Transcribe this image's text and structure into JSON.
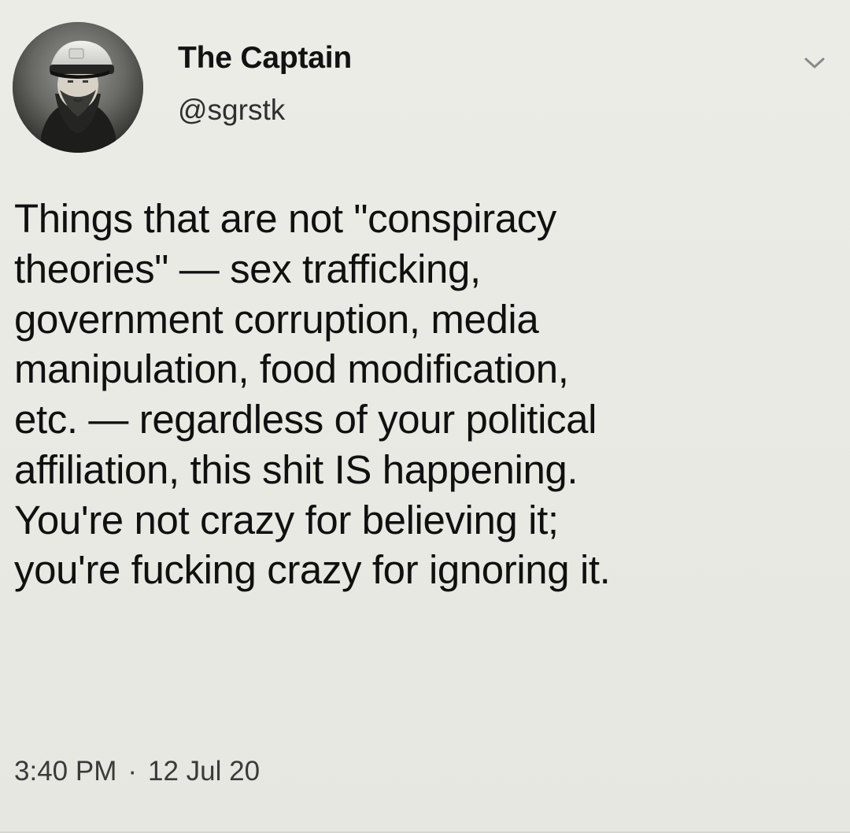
{
  "tweet": {
    "author": {
      "display_name": "The Captain",
      "handle": "@sgrstk",
      "avatar_icon": "avatar-image"
    },
    "menu_icon": "chevron-down-icon",
    "text_lines": [
      "Things that are not \"conspiracy",
      "theories\" — sex trafficking,",
      "government corruption, media",
      "manipulation, food modification,",
      "etc. — regardless of your political",
      "affiliation, this shit IS happening.",
      "You're not crazy for believing it;",
      "you're fucking crazy for ignoring it."
    ],
    "time": "3:40 PM",
    "separator": "·",
    "date": "12 Jul 20"
  },
  "colors": {
    "background": "#e9e9e4",
    "text_primary": "#111111",
    "text_secondary": "#3a3a3a",
    "icon": "#8a8a8a"
  }
}
